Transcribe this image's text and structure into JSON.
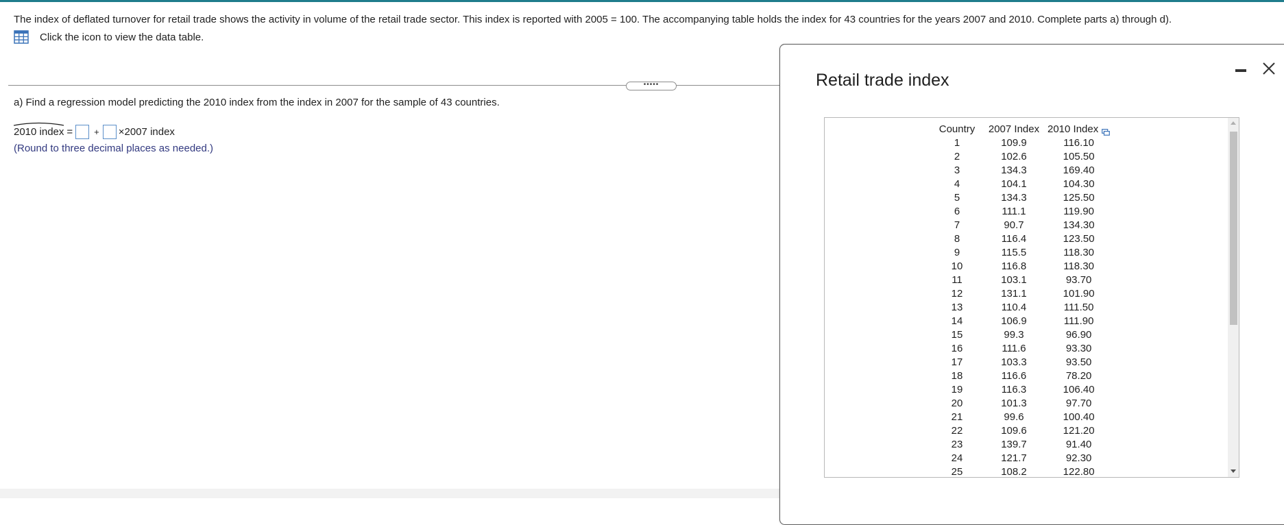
{
  "problem": {
    "intro_text": "The index of deflated turnover for retail trade shows the activity in volume of the retail trade sector. This index is reported with 2005 = 100. The accompanying table holds the index for 43 countries for the years 2007 and 2010. Complete parts a) through d).",
    "table_link_text": "Click the icon to view the data table.",
    "handle_text": "•••••",
    "part_a_text": "a) Find a regression model predicting the 2010 index from the index in 2007 for the sample of 43 countries.",
    "equation": {
      "lhs": "2010 index",
      "equals": "=",
      "plus": "+",
      "times": "×",
      "rhs_var": "2007 index",
      "intercept_value": "",
      "slope_value": ""
    },
    "round_note": "(Round to three decimal places as needed.)"
  },
  "dialog": {
    "title": "Retail trade index",
    "minimize_icon": "minimize-icon",
    "close_icon": "close-icon",
    "table": {
      "headers": [
        "Country",
        "2007 Index",
        "2010 Index"
      ],
      "rows": [
        [
          "1",
          "109.9",
          "116.10"
        ],
        [
          "2",
          "102.6",
          "105.50"
        ],
        [
          "3",
          "134.3",
          "169.40"
        ],
        [
          "4",
          "104.1",
          "104.30"
        ],
        [
          "5",
          "134.3",
          "125.50"
        ],
        [
          "6",
          "111.1",
          "119.90"
        ],
        [
          "7",
          "90.7",
          "134.30"
        ],
        [
          "8",
          "116.4",
          "123.50"
        ],
        [
          "9",
          "115.5",
          "118.30"
        ],
        [
          "10",
          "116.8",
          "118.30"
        ],
        [
          "11",
          "103.1",
          "93.70"
        ],
        [
          "12",
          "131.1",
          "101.90"
        ],
        [
          "13",
          "110.4",
          "111.50"
        ],
        [
          "14",
          "106.9",
          "111.90"
        ],
        [
          "15",
          "99.3",
          "96.90"
        ],
        [
          "16",
          "111.6",
          "93.30"
        ],
        [
          "17",
          "103.3",
          "93.50"
        ],
        [
          "18",
          "116.6",
          "78.20"
        ],
        [
          "19",
          "116.3",
          "106.40"
        ],
        [
          "20",
          "101.3",
          "97.70"
        ],
        [
          "21",
          "99.6",
          "100.40"
        ],
        [
          "22",
          "109.6",
          "121.20"
        ],
        [
          "23",
          "139.7",
          "91.40"
        ],
        [
          "24",
          "121.7",
          "92.30"
        ],
        [
          "25",
          "108.2",
          "122.80"
        ]
      ]
    }
  },
  "colors": {
    "accent_bar": "#1f7c8c",
    "answer_box_border": "#5b8fc9",
    "note_text": "#333a80",
    "table_icon": "#3b73b9"
  }
}
